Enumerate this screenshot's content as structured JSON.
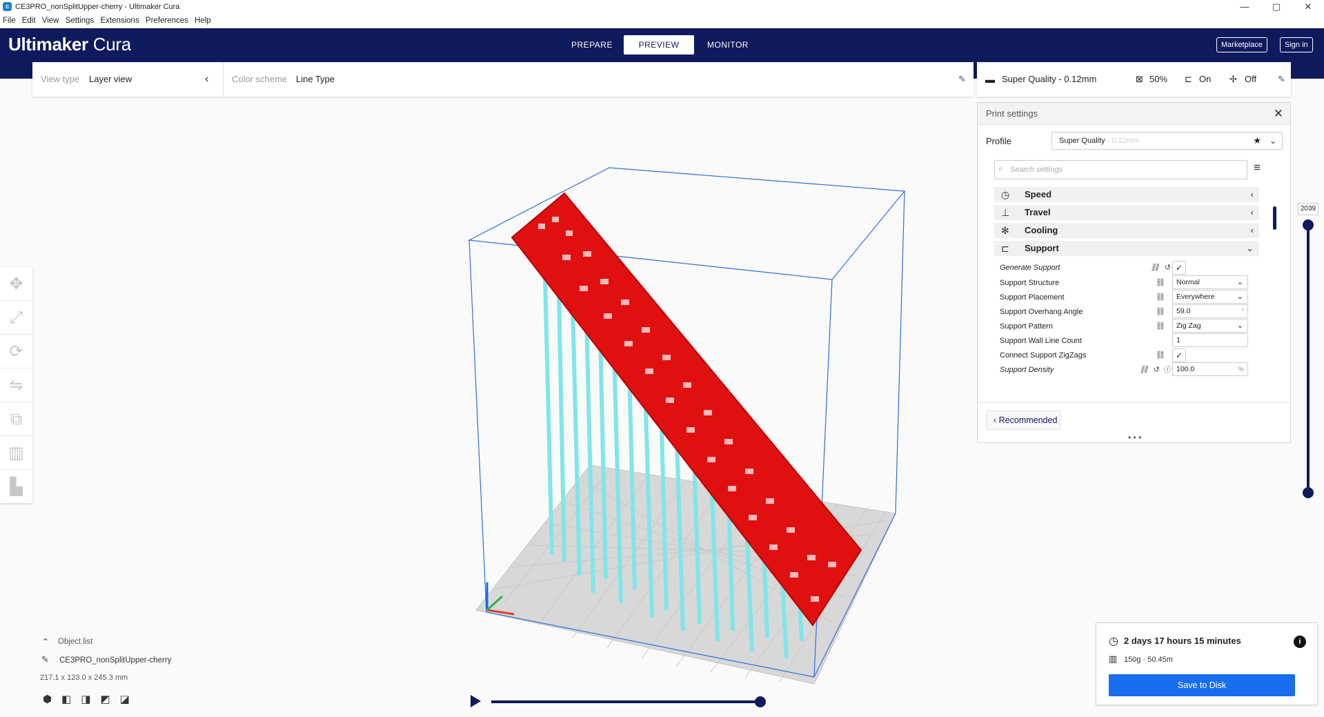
{
  "window": {
    "title": "CE3PRO_nonSplitUpper-cherry - Ultimaker Cura",
    "icon": "cura-app-icon",
    "controls": {
      "minimize": "—",
      "maximize": "▢",
      "close": "✕"
    }
  },
  "menu": [
    "File",
    "Edit",
    "View",
    "Settings",
    "Extensions",
    "Preferences",
    "Help"
  ],
  "header": {
    "brand_main": "Ultimaker",
    "brand_sub": " Cura",
    "stages": [
      {
        "label": "PREPARE",
        "active": false
      },
      {
        "label": "PREVIEW",
        "active": true
      },
      {
        "label": "MONITOR",
        "active": false
      }
    ],
    "marketplace": "Marketplace",
    "signin": "Sign in"
  },
  "viewbar": {
    "view_type_label": "View type",
    "view_type_value": "Layer view",
    "color_scheme_label": "Color scheme",
    "color_scheme_value": "Line Type"
  },
  "printbar": {
    "profile": "Super Quality - 0.12mm",
    "infill": "50%",
    "support": "On",
    "adhesion": "Off"
  },
  "panel": {
    "title": "Print settings",
    "profile_label": "Profile",
    "profile_value": "Super Quality",
    "profile_dim": " - 0.12mm",
    "search_placeholder": "Search settings",
    "categories": [
      {
        "label": "Speed",
        "icon": "speed-icon",
        "expanded": false
      },
      {
        "label": "Travel",
        "icon": "travel-icon",
        "expanded": false
      },
      {
        "label": "Cooling",
        "icon": "fan-icon",
        "expanded": false
      },
      {
        "label": "Support",
        "icon": "support-icon",
        "expanded": true
      }
    ],
    "settings": [
      {
        "label": "Generate Support",
        "type": "check",
        "value": "✓",
        "italic": true
      },
      {
        "label": "Support Structure",
        "type": "select",
        "value": "Normal"
      },
      {
        "label": "Support Placement",
        "type": "select",
        "value": "Everywhere"
      },
      {
        "label": "Support Overhang Angle",
        "type": "number",
        "value": "59.0",
        "unit": "°"
      },
      {
        "label": "Support Pattern",
        "type": "select",
        "value": "Zig Zag"
      },
      {
        "label": "Support Wall Line Count",
        "type": "number",
        "value": "1",
        "unit": ""
      },
      {
        "label": "Connect Support ZigZags",
        "type": "check",
        "value": "✓"
      },
      {
        "label": "Support Density",
        "type": "number",
        "value": "100.0",
        "unit": "%",
        "italic": true
      }
    ],
    "recommended": "Recommended",
    "more": "• • •"
  },
  "layer_slider": {
    "max_layer": "2039"
  },
  "object_list": {
    "toggle": "Object list",
    "name": "CE3PRO_nonSplitUpper-cherry",
    "dimensions": "217.1 x 123.0 x 245.3 mm"
  },
  "job": {
    "time": "2 days 17 hours 15 minutes",
    "material": "150g · 50.45m",
    "save": "Save to Disk"
  },
  "colors": {
    "brand_navy": "#0e1a5c",
    "save_blue": "#196ef0",
    "model_red": "#e01010",
    "support_cyan": "#7fe6ea"
  }
}
